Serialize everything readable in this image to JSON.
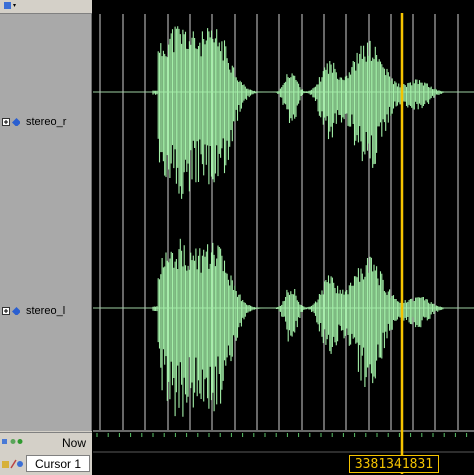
{
  "signals": [
    {
      "name": "stereo_r"
    },
    {
      "name": "stereo_l"
    }
  ],
  "timeline": {
    "now_label": "Now"
  },
  "cursor": {
    "name": "Cursor 1",
    "time_value": "3381341831"
  },
  "colors": {
    "waveform": "#a3f0a8",
    "cursor_line": "#f5c400",
    "grid": "#d0d0d0",
    "signal_list_bg": "#a9a9a9",
    "panel_bg": "#d4d0c8",
    "wave_bg": "#000000"
  }
}
